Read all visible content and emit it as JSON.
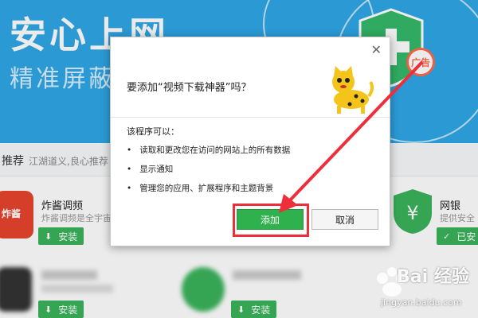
{
  "banner": {
    "title": "安心上网",
    "subtitle": "精准屏蔽",
    "ad_tag": "广告",
    "accent": "#2ea7e6"
  },
  "recommend": {
    "label": "推荐",
    "subtitle": "江湖道义,良心推荐"
  },
  "apps": [
    {
      "name": "炸酱调频",
      "desc": "炸酱调频是全宇宙",
      "action": "安装",
      "icon_text": "炸酱",
      "icon_color": "#e8452d"
    },
    {
      "name": "网银",
      "desc": "提供安全",
      "action": "已安",
      "icon": "yuan-shield-icon",
      "icon_color": "#3ab35c"
    },
    {
      "name": "",
      "desc": "",
      "action": "安装",
      "icon_color": "#333333"
    },
    {
      "name": "",
      "desc": "",
      "action": "安装",
      "icon_color": "#3ab35c"
    }
  ],
  "dialog": {
    "title": "要添加“视频下载神器”吗？",
    "can_label": "该程序可以：",
    "permissions": [
      "读取和更改您在访问的网站上的所有数据",
      "显示通知",
      "管理您的应用、扩展程序和主题背景"
    ],
    "add_label": "添加",
    "cancel_label": "取消",
    "close_icon": "close-icon",
    "ext_icon": "cat-icon"
  },
  "annotation": {
    "highlight_color": "#ee2e3b"
  },
  "watermark": {
    "text": "Bai 经验",
    "url": "jingyan.baidu.com"
  }
}
